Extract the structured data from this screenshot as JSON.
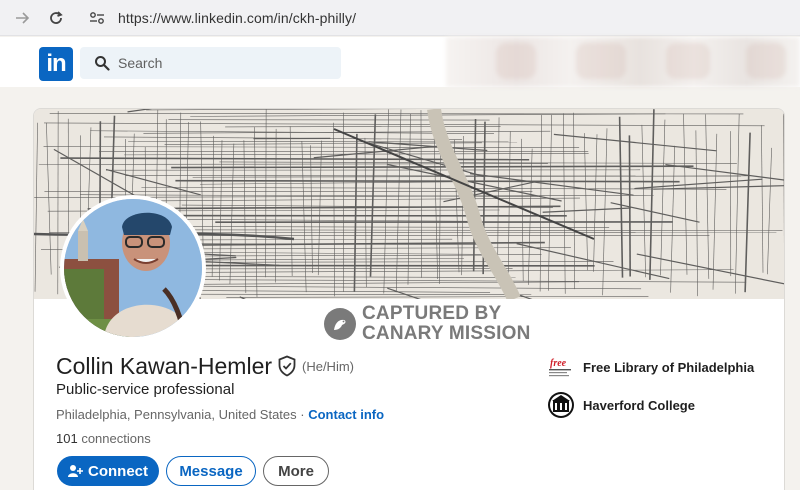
{
  "browser": {
    "url": "https://www.linkedin.com/in/ckh-philly/",
    "icons": [
      "arrow-back-icon",
      "reload-icon",
      "site-settings-icon"
    ]
  },
  "header": {
    "logo_text": "in",
    "search_placeholder": "Search"
  },
  "watermark": {
    "line1": "CAPTURED BY",
    "line2": "CANARY MISSION"
  },
  "profile": {
    "name": "Collin Kawan-Hemler",
    "pronouns": "(He/Him)",
    "headline": "Public-service professional",
    "location": "Philadelphia, Pennsylvania, United States",
    "separator": " · ",
    "contact_info": "Contact info",
    "connections_count": "101",
    "connections_label": " connections"
  },
  "actions": {
    "connect": "Connect",
    "message": "Message",
    "more": "More"
  },
  "organizations": [
    {
      "name": "Free Library of Philadelphia",
      "logo_text": "free"
    },
    {
      "name": "Haverford College"
    }
  ],
  "colors": {
    "accent": "#0a66c2",
    "background": "#f4f2ee",
    "watermark": "#7a7a7a"
  }
}
